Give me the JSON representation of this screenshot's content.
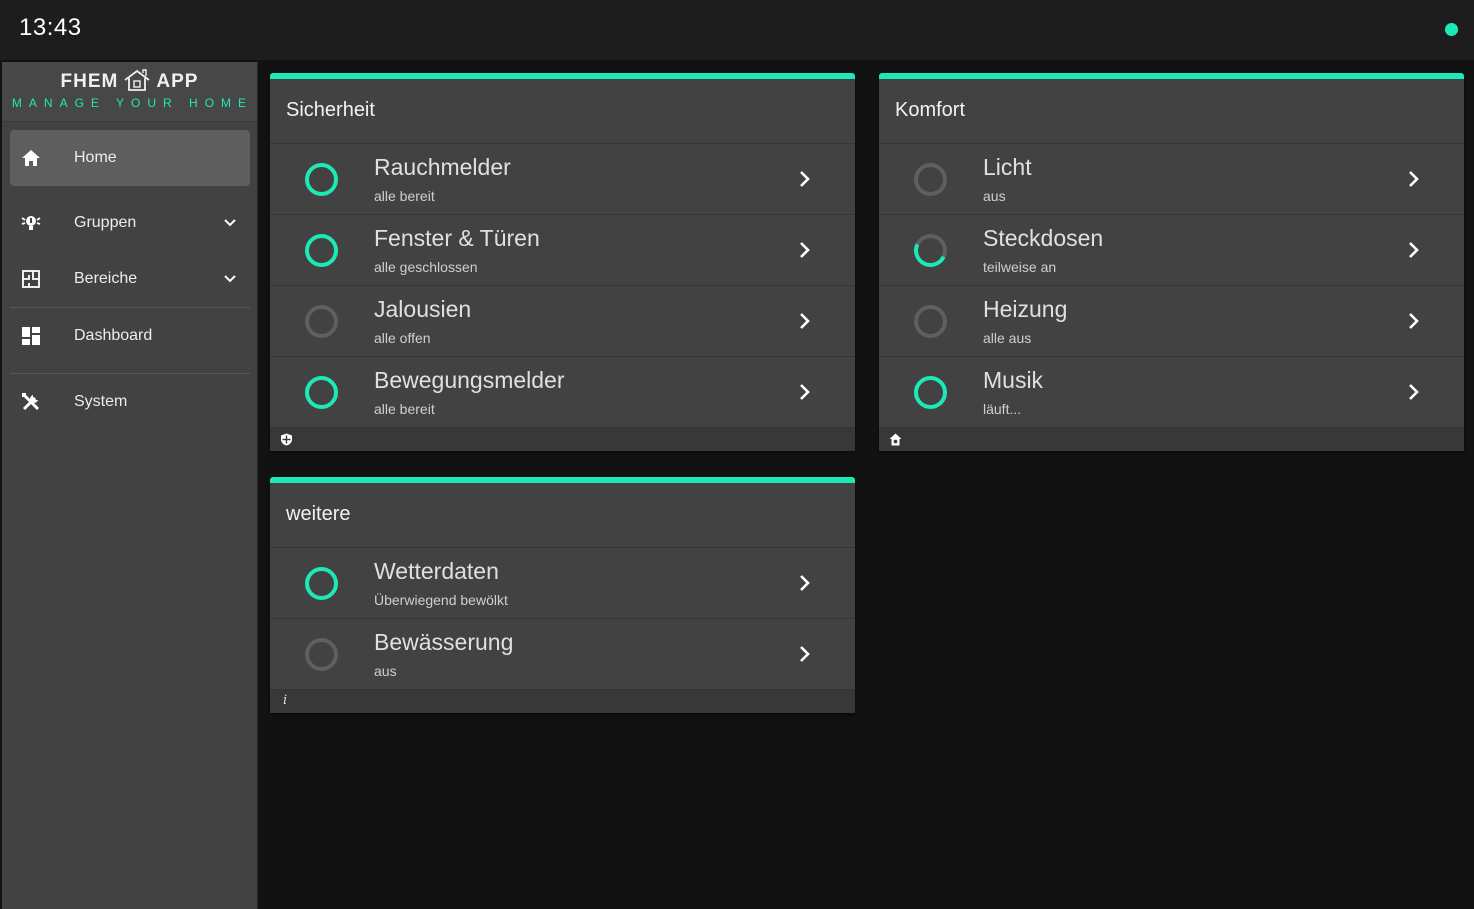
{
  "header": {
    "time": "13:43",
    "status_color": "#1de9b6"
  },
  "logo": {
    "left": "FHEM",
    "right": "APP",
    "subtitle": "MANAGE YOUR HOME"
  },
  "accent": "#1de9b6",
  "nav": [
    {
      "label": "Home",
      "icon": "home-icon",
      "active": true
    },
    {
      "label": "Gruppen",
      "icon": "groups-icon",
      "expandable": true
    },
    {
      "label": "Bereiche",
      "icon": "floorplan-icon",
      "expandable": true
    },
    {
      "label": "Dashboard",
      "icon": "dashboard-icon"
    },
    {
      "label": "System",
      "icon": "tools-icon"
    }
  ],
  "cards": [
    {
      "title": "Sicherheit",
      "footer_icon": "shield-icon",
      "items": [
        {
          "name": "Rauchmelder",
          "status": "alle bereit",
          "state": "on"
        },
        {
          "name": "Fenster & Türen",
          "status": "alle geschlossen",
          "state": "on"
        },
        {
          "name": "Jalousien",
          "status": "alle offen",
          "state": "off"
        },
        {
          "name": "Bewegungsmelder",
          "status": "alle bereit",
          "state": "on"
        }
      ]
    },
    {
      "title": "Komfort",
      "footer_icon": "home-comfort-icon",
      "items": [
        {
          "name": "Licht",
          "status": "aus",
          "state": "off"
        },
        {
          "name": "Steckdosen",
          "status": "teilweise an",
          "state": "partial"
        },
        {
          "name": "Heizung",
          "status": "alle aus",
          "state": "off"
        },
        {
          "name": "Musik",
          "status": "läuft...",
          "state": "on"
        }
      ]
    },
    {
      "title": "weitere",
      "footer_text": "i",
      "items": [
        {
          "name": "Wetterdaten",
          "status": "Überwiegend bewölkt",
          "state": "on"
        },
        {
          "name": "Bewässerung",
          "status": "aus",
          "state": "off"
        }
      ]
    }
  ]
}
